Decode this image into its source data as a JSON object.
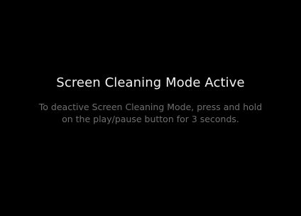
{
  "screen": {
    "title": "Screen Cleaning Mode Active",
    "message_line1": "To deactive Screen Cleaning Mode, press and hold",
    "message_line2": "on the play/pause button for 3 seconds."
  }
}
